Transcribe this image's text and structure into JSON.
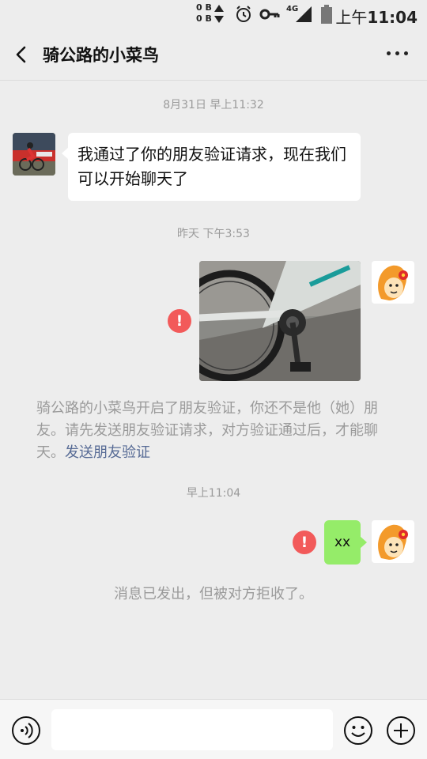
{
  "status_bar": {
    "net_up": "0 B",
    "net_down": "0 B",
    "network_type": "4G",
    "time_prefix": "上午",
    "time": "11:04"
  },
  "header": {
    "title": "骑公路的小菜鸟"
  },
  "messages": {
    "ts1": "8月31日 早上11:32",
    "msg1_text": "我通过了你的朋友验证请求，现在我们可以开始聊天了",
    "ts2": "昨天 下午3:53",
    "system_notice": "骑公路的小菜鸟开启了朋友验证，你还不是他（她）朋友。请先发送朋友验证请求，对方验证通过后，才能聊天。",
    "system_link": "发送朋友验证",
    "ts3": "早上11:04",
    "msg3_text": "xx",
    "reject_notice": "消息已发出，但被对方拒收了。"
  },
  "icons": {
    "error": "!"
  },
  "colors": {
    "background": "#ededed",
    "bubble_sent": "#95ec69",
    "bubble_received": "#ffffff",
    "error": "#f25a5a",
    "link": "#576b95"
  }
}
